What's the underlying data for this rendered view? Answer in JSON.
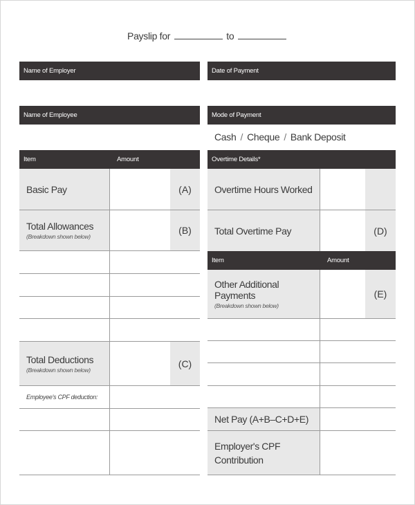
{
  "title": {
    "prefix": "Payslip for",
    "to": "to"
  },
  "employer": {
    "label": "Name of Employer"
  },
  "employee": {
    "label": "Name of Employee"
  },
  "date_of_payment": {
    "label": "Date of Payment"
  },
  "mode_of_payment": {
    "label": "Mode of Payment",
    "options": [
      "Cash",
      "Cheque",
      "Bank Deposit"
    ],
    "separator": "/"
  },
  "earnings_table": {
    "headers": {
      "item": "Item",
      "amount": "Amount"
    },
    "basic_pay": {
      "label": "Basic Pay",
      "code": "(A)"
    },
    "total_allowances": {
      "label": "Total Allowances",
      "note": "(Breakdown shown below)",
      "code": "(B)"
    },
    "total_deductions": {
      "label": "Total Deductions",
      "note": "(Breakdown shown below)",
      "code": "(C)"
    },
    "cpf_deduction": {
      "label": "Employee's CPF deduction:"
    }
  },
  "overtime": {
    "header": "Overtime Details*",
    "hours_worked": {
      "label": "Overtime Hours Worked"
    },
    "total_pay": {
      "label": "Total Overtime Pay",
      "code": "(D)"
    }
  },
  "additional_table": {
    "headers": {
      "item": "Item",
      "amount": "Amount"
    },
    "other_payments": {
      "label": "Other Additional Payments",
      "note": "(Breakdown shown below)",
      "code": "(E)"
    },
    "net_pay": {
      "label": "Net Pay (A+B–C+D+E)"
    },
    "employer_cpf": {
      "label_line1": "Employer's CPF",
      "label_line2": "Contribution"
    }
  },
  "colors": {
    "header_bar": "#383435",
    "shaded_cell": "#e8e8e8",
    "rule": "#9a9a9a"
  }
}
